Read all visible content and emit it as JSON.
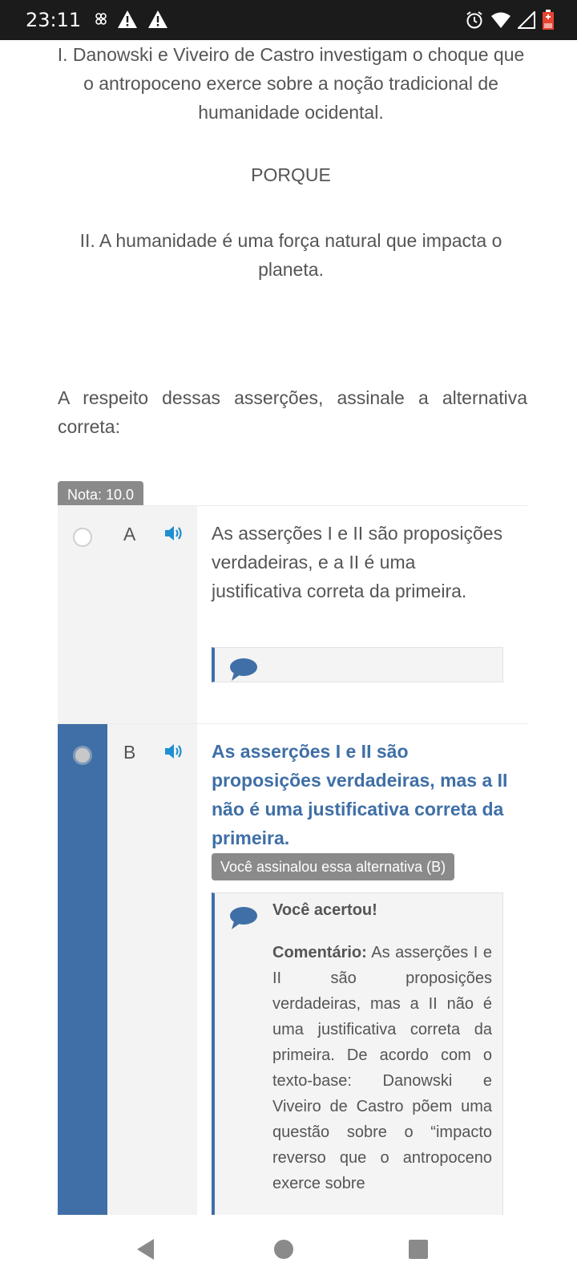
{
  "status_bar": {
    "time": "23:11",
    "left_icons": [
      "link-icon",
      "warning-icon",
      "warning-icon"
    ],
    "right_icons": [
      "alarm-icon",
      "wifi-icon",
      "signal-icon",
      "battery-charging-icon"
    ]
  },
  "question": {
    "assertion_1": "I. Danowski e Viveiro de Castro investigam o choque que o antropoceno exerce sobre a noção tradicional de humanidade ocidental.",
    "connector": "PORQUE",
    "assertion_2": "II. A humanidade é uma força natural que impacta o planeta.",
    "prompt": "A respeito dessas asserções, assinale a alternativa correta:"
  },
  "grade_badge": "Nota: 10.0",
  "alternatives": [
    {
      "letter": "A",
      "text": "As asserções I e II são proposições verdadeiras, e a II é uma justificativa correta da primeira.",
      "selected": false
    },
    {
      "letter": "B",
      "text": "As asserções I e II são proposições verdadeiras, mas a II não é uma justificativa correta da primeira.",
      "selected": true,
      "selected_badge": "Você assinalou essa alternativa (B)",
      "feedback_title": "Você acertou!",
      "comment_label": "Comentário:",
      "comment_text": " As asserções I e II são proposições verdadeiras, mas a II não é uma justificativa correta da primeira. De acordo com o texto-base: Danowski e Viveiro de Castro põem uma questão sobre o “impacto reverso que o antropoceno exerce sobre"
    }
  ],
  "colors": {
    "accent_blue": "#3f6fa6",
    "badge_gray": "#8a8a8a",
    "status_bar_bg": "#1b1b1b"
  },
  "nav_bar": [
    "back-icon",
    "home-icon",
    "recents-icon"
  ]
}
